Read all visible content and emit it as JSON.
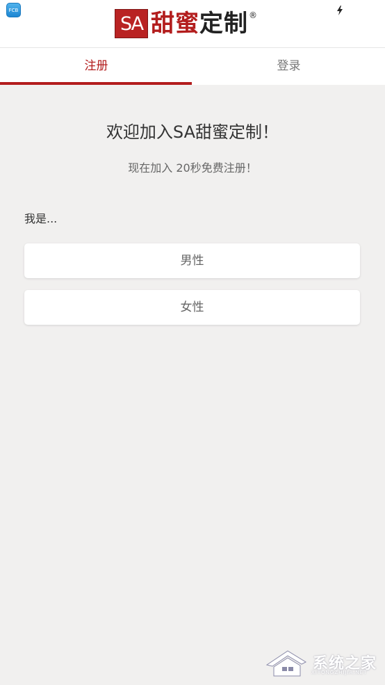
{
  "status_bar": {
    "app_icon_text": "FCB",
    "charging_icon": "lightning-bolt-icon"
  },
  "header": {
    "logo_mark": "SA",
    "logo_red_text": "甜蜜",
    "logo_dark_text": "定制",
    "logo_reg": "®"
  },
  "tabs": [
    {
      "label": "注册",
      "active": true
    },
    {
      "label": "登录",
      "active": false
    }
  ],
  "welcome": {
    "title": "欢迎加入SA甜蜜定制！",
    "subtitle": "现在加入 20秒免费注册！"
  },
  "gender_select": {
    "label": "我是...",
    "options": [
      "男性",
      "女性"
    ]
  },
  "watermark": {
    "text": "系统之家",
    "url": "XITONGZHIJIA.NET"
  },
  "colors": {
    "accent": "#b31d1d",
    "background": "#f1f0ef",
    "card": "#ffffff"
  }
}
